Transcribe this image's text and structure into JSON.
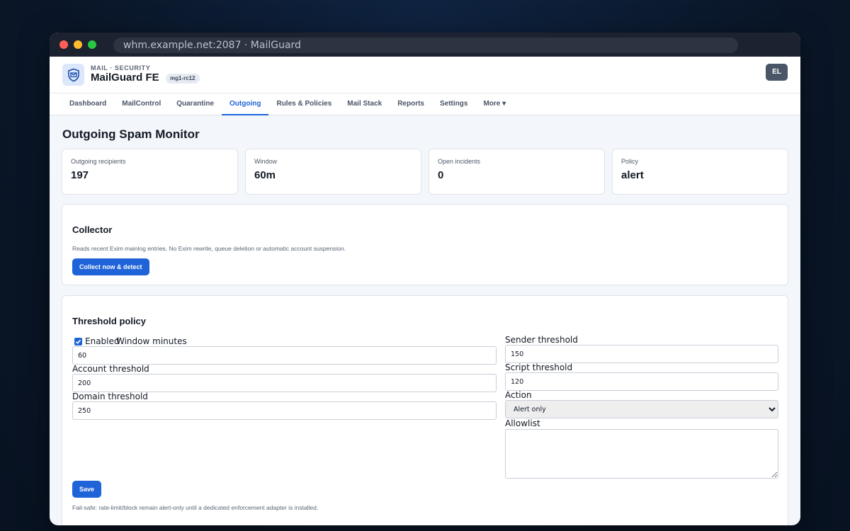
{
  "browser": {
    "url": "whm.example.net:2087 · MailGuard"
  },
  "header": {
    "subtitle": "MAIL · SECURITY",
    "title": "MailGuard FE",
    "version_badge": "mg1-rc12",
    "avatar_initials": "EL",
    "accent_color": "#1f63d8"
  },
  "nav": {
    "items": [
      {
        "label": "Dashboard"
      },
      {
        "label": "MailControl"
      },
      {
        "label": "Quarantine"
      },
      {
        "label": "Outgoing"
      },
      {
        "label": "Rules & Policies"
      },
      {
        "label": "Mail Stack"
      },
      {
        "label": "Reports"
      },
      {
        "label": "Settings"
      },
      {
        "label": "More ▾"
      }
    ],
    "active": "Outgoing"
  },
  "page": {
    "title": "Outgoing Spam Monitor"
  },
  "stats": [
    {
      "label": "Outgoing recipients",
      "value": "197"
    },
    {
      "label": "Window",
      "value": "60m"
    },
    {
      "label": "Open incidents",
      "value": "0"
    },
    {
      "label": "Policy",
      "value": "alert"
    }
  ],
  "collector": {
    "title": "Collector",
    "description": "Reads recent Exim mainlog entries. No Exim rewrite, queue deletion or automatic account suspension.",
    "button_label": "Collect now & detect"
  },
  "threshold": {
    "title": "Threshold policy",
    "enabled_label": "Enabled",
    "enabled": true,
    "window_label": "Window minutes",
    "window_value": "60",
    "account_label": "Account threshold",
    "account_value": "200",
    "domain_label": "Domain threshold",
    "domain_value": "250",
    "sender_label": "Sender threshold",
    "sender_value": "150",
    "script_label": "Script threshold",
    "script_value": "120",
    "action_label": "Action",
    "action_value": "Alert only",
    "allowlist_label": "Allowlist",
    "allowlist_value": "",
    "save_label": "Save",
    "failsafe_note": "Fail-safe: rate-limit/block remain alert-only until a dedicated enforcement adapter is installed."
  }
}
